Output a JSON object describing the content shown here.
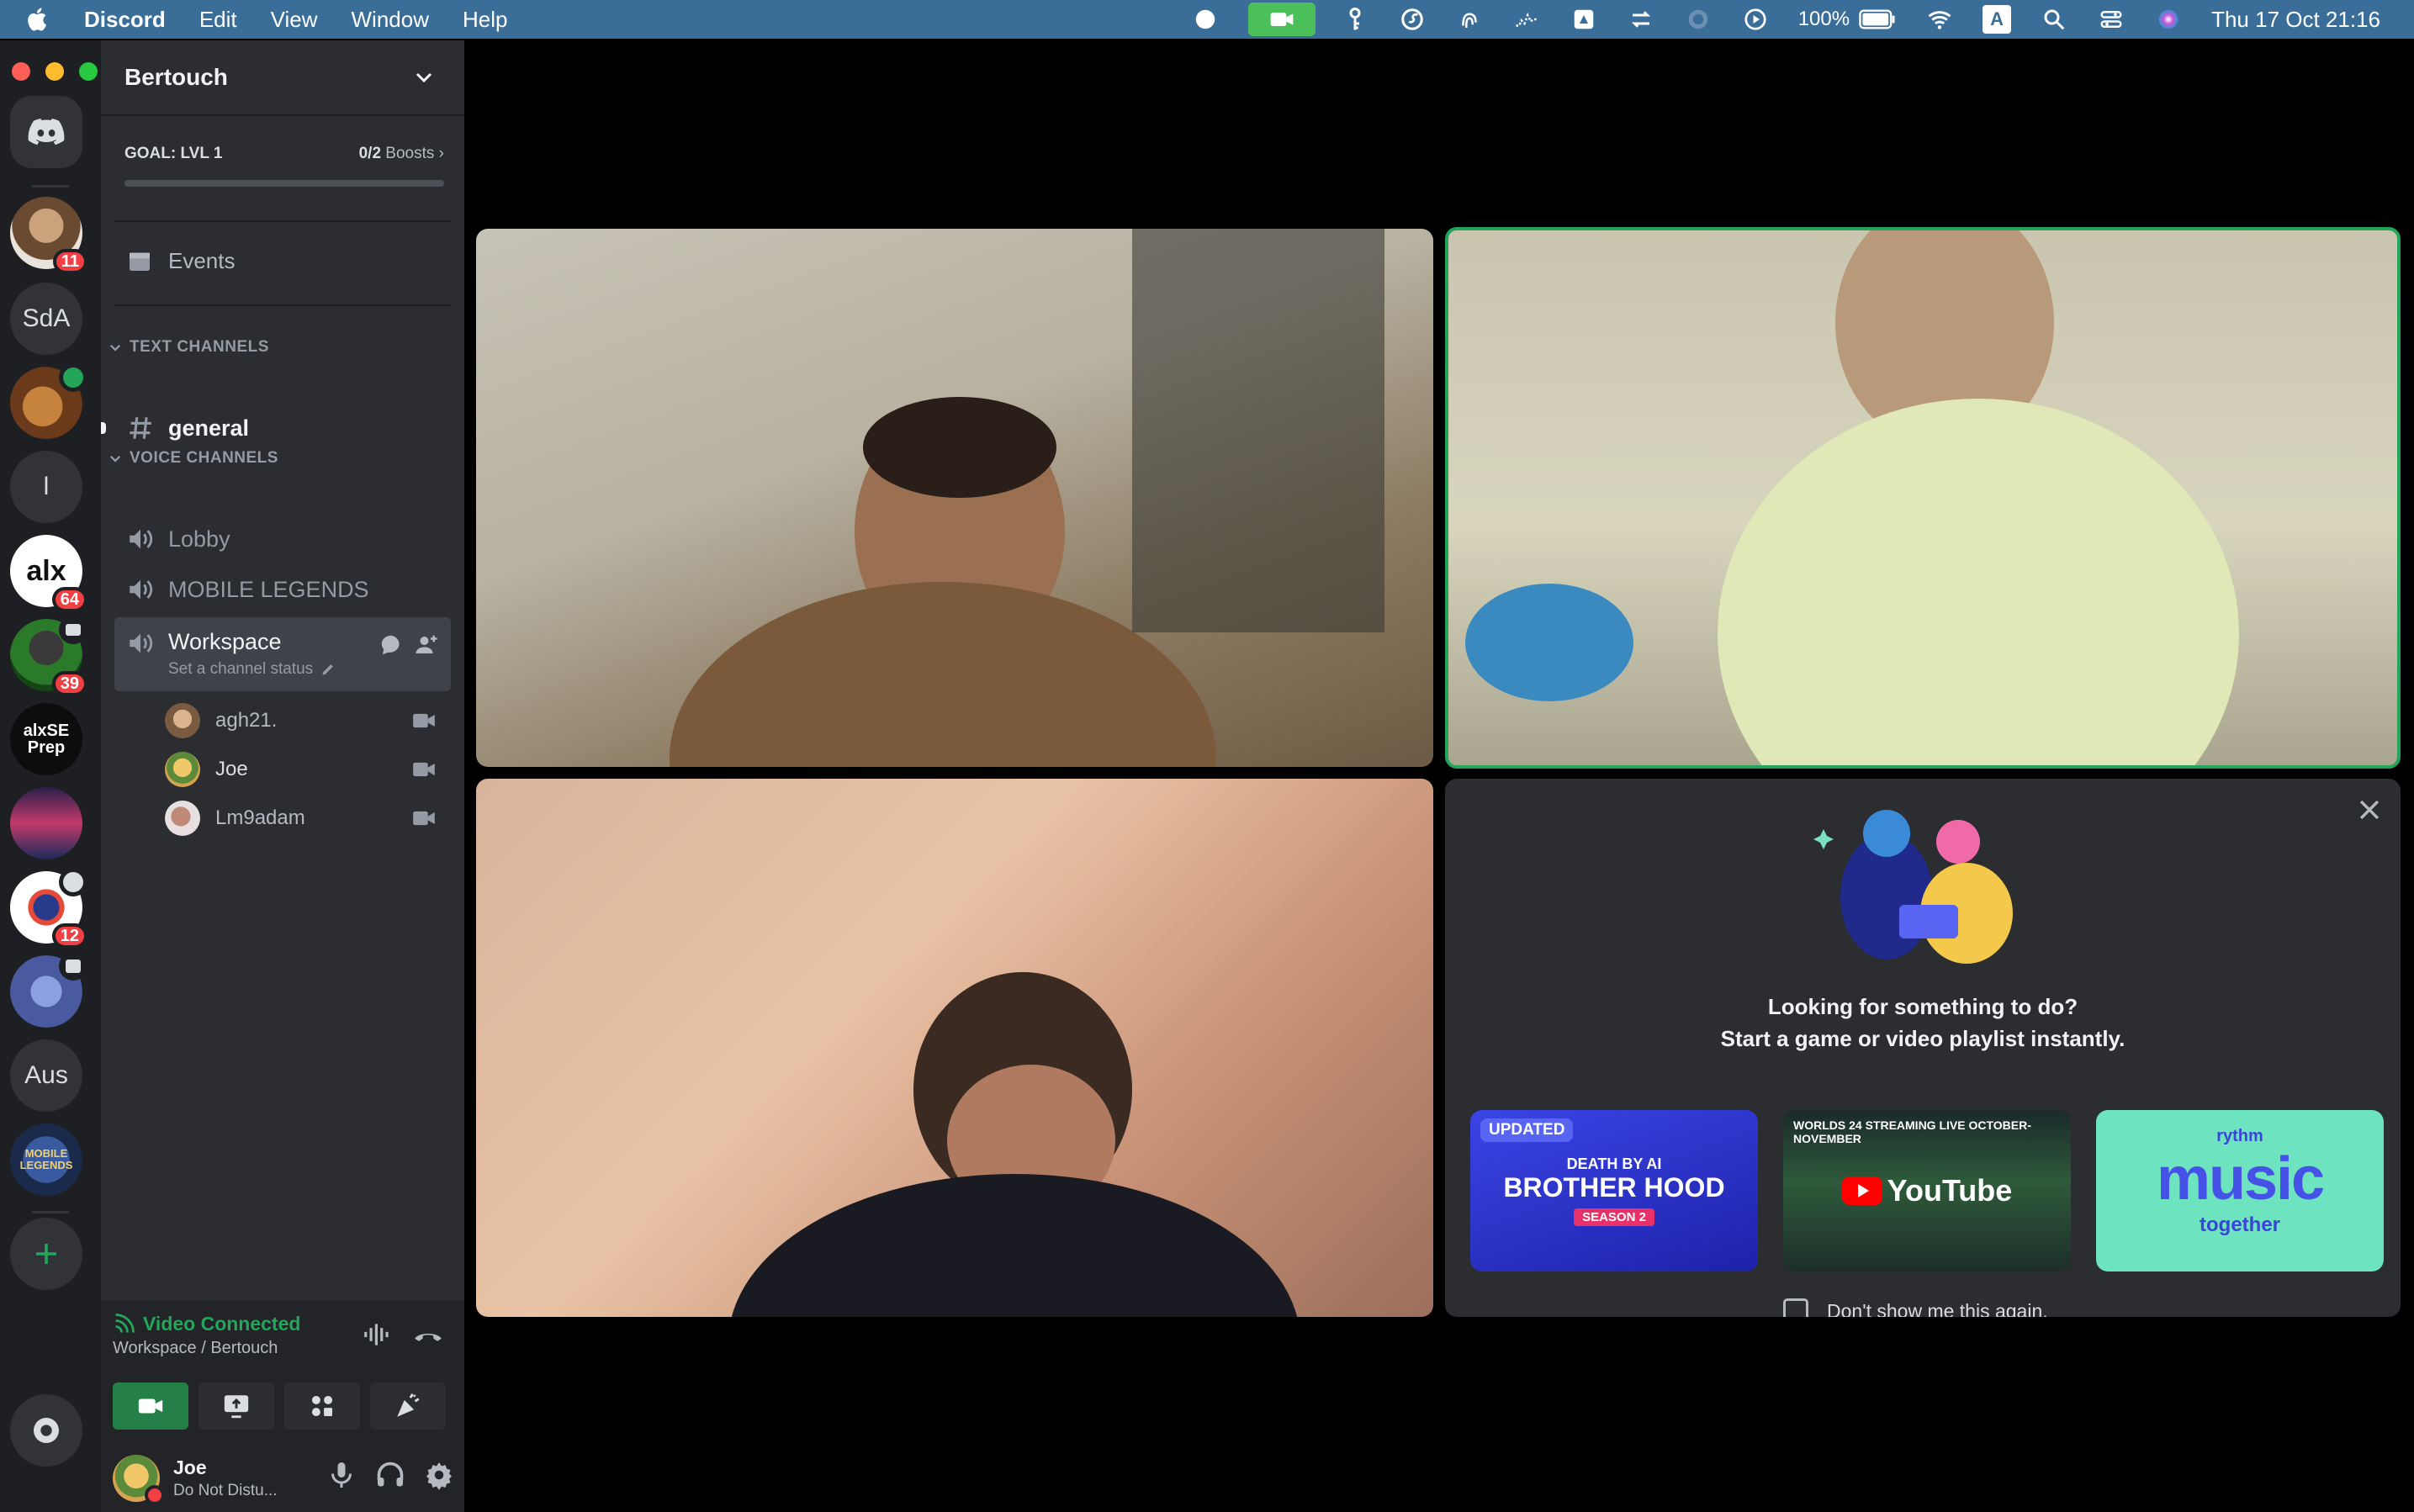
{
  "menubar": {
    "app_name": "Discord",
    "menus": [
      "Edit",
      "View",
      "Window",
      "Help"
    ],
    "battery": "100%",
    "input_badge": "A",
    "clock": "Thu 17 Oct  21:16"
  },
  "servers": {
    "items": [
      {
        "label": "",
        "badge": "11"
      },
      {
        "label": "SdA",
        "badge": ""
      },
      {
        "label": "",
        "badge": ""
      },
      {
        "label": "l",
        "badge": ""
      },
      {
        "label": "alx",
        "badge": "64"
      },
      {
        "label": "",
        "badge": "39"
      },
      {
        "label": "alxSE Prep",
        "badge": ""
      },
      {
        "label": "",
        "badge": ""
      },
      {
        "label": "",
        "badge": "12"
      },
      {
        "label": "",
        "badge": ""
      },
      {
        "label": "Aus",
        "badge": ""
      },
      {
        "label": "MOBILE LEGENDS",
        "badge": ""
      }
    ]
  },
  "sidebar": {
    "server_name": "Bertouch",
    "goal_label": "GOAL: LVL 1",
    "boosts_count": "0/2",
    "boosts_label": "Boosts",
    "events_label": "Events",
    "text_category": "TEXT CHANNELS",
    "text_channels": [
      {
        "name": "general"
      }
    ],
    "voice_category": "VOICE CHANNELS",
    "voice_channels": [
      {
        "name": "Lobby"
      },
      {
        "name": "MOBILE LEGENDS"
      },
      {
        "name": "Workspace",
        "status": "Set a channel status"
      }
    ],
    "voice_users": [
      {
        "name": "agh21."
      },
      {
        "name": "Joe"
      },
      {
        "name": "Lm9adam"
      }
    ]
  },
  "voice_panel": {
    "title": "Video Connected",
    "subtitle": "Workspace / Bertouch"
  },
  "user_panel": {
    "name": "Joe",
    "status": "Do Not Distu..."
  },
  "activity": {
    "title_line1": "Looking for something to do?",
    "title_line2": "Start a game or video playlist instantly.",
    "cards": [
      {
        "tag": "UPDATED",
        "line1": "DEATH BY AI",
        "line2": "BROTHER HOOD",
        "line3": "SEASON 2"
      },
      {
        "top": "WORLDS 24  STREAMING LIVE OCTOBER-NOVEMBER",
        "brand": "YouTube"
      },
      {
        "brand": "rythm",
        "big": "music",
        "sub": "together"
      }
    ],
    "checkbox_label": "Don't show me this again."
  },
  "colors": {
    "accent_green": "#23a55a",
    "blurple": "#5865f2",
    "dnd_red": "#f23f43"
  }
}
